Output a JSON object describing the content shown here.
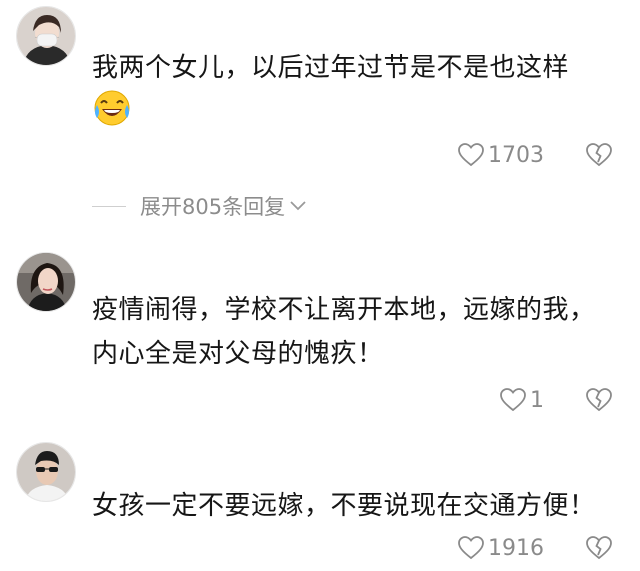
{
  "comments": [
    {
      "avatar_icon": "woman-face-mask-avatar",
      "text": "我两个女儿，以后过年过节是不是也这样",
      "emoji_icon": "laughing-tears-emoji",
      "likes": "1703",
      "replies_label": "展开805条回复"
    },
    {
      "avatar_icon": "woman-selfie-avatar",
      "text": "疫情闹得，学校不让离开本地，远嫁的我，内心全是对父母的愧疚！",
      "likes": "1"
    },
    {
      "avatar_icon": "man-sunglasses-avatar",
      "text": "女孩一定不要远嫁，不要说现在交通方便！",
      "likes": "1916"
    }
  ],
  "colors": {
    "text": "#161616",
    "muted": "#8a8a8a",
    "background": "#ffffff"
  }
}
